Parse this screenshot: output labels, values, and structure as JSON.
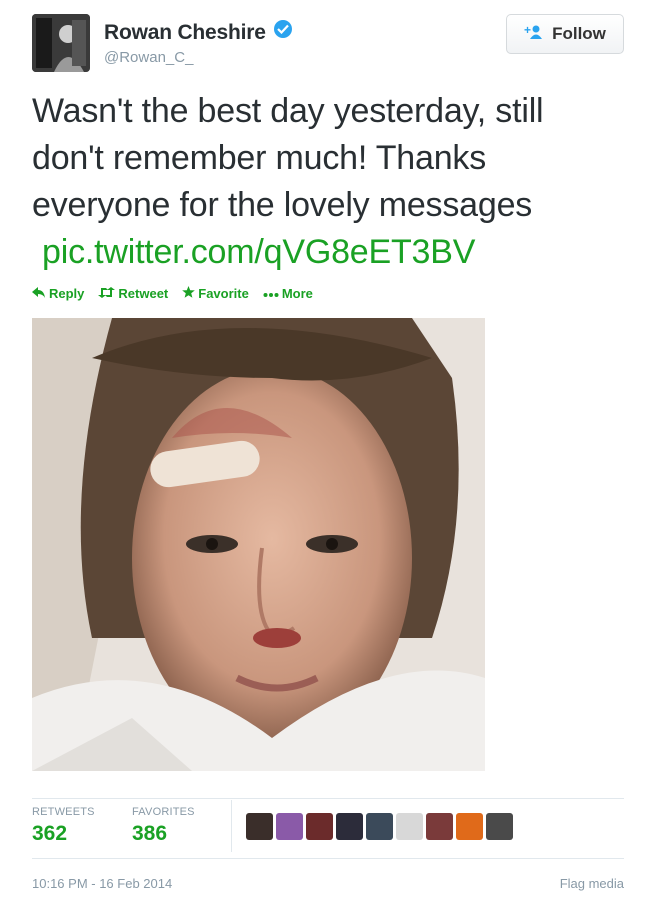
{
  "user": {
    "name": "Rowan Cheshire",
    "handle": "@Rowan_C_",
    "verified_color": "#2aa3ef"
  },
  "follow_button": {
    "label": "Follow"
  },
  "tweet": {
    "text": "Wasn't the best day yesterday, still don't remember much! Thanks everyone for the lovely messages",
    "link": "pic.twitter.com/qVG8eET3BV",
    "link_color": "#1aa124"
  },
  "actions": [
    {
      "label": "Reply",
      "icon": "reply-icon"
    },
    {
      "label": "Retweet",
      "icon": "retweet-icon"
    },
    {
      "label": "Favorite",
      "icon": "star-icon"
    },
    {
      "label": "More",
      "icon": "more-dots-icon"
    }
  ],
  "stats": {
    "retweets_label": "RETWEETS",
    "retweets": "362",
    "favorites_label": "FAVORITES",
    "favorites": "386"
  },
  "favoriter_avatar_colors": [
    "#3a2e2a",
    "#8a5aa8",
    "#6b2b2b",
    "#2c2c3a",
    "#3b4a5a",
    "#d8d8d8",
    "#7a3a3a",
    "#e06a1a",
    "#4a4a4a"
  ],
  "timestamp": "10:16 PM - 16 Feb 2014",
  "flag_media": "Flag media"
}
